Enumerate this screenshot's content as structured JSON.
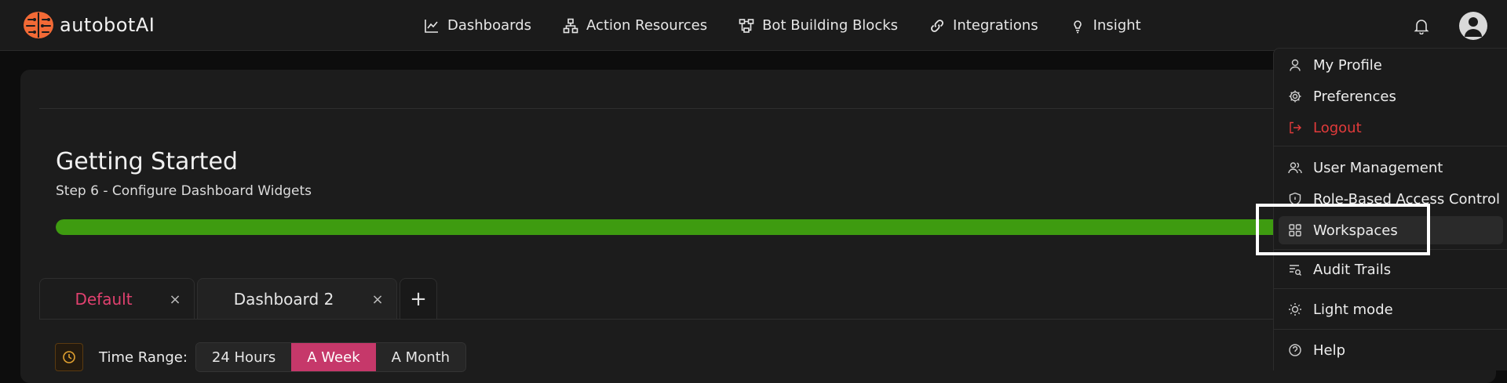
{
  "brand": {
    "name": "autobotAI",
    "logo_icon": "brain-icon",
    "accent": "#f26a36"
  },
  "nav": [
    {
      "label": "Dashboards",
      "icon": "chart-line-icon"
    },
    {
      "label": "Action Resources",
      "icon": "sitemap-icon"
    },
    {
      "label": "Bot Building Blocks",
      "icon": "blocks-icon"
    },
    {
      "label": "Integrations",
      "icon": "link-icon"
    },
    {
      "label": "Insight",
      "icon": "lightbulb-icon"
    }
  ],
  "getting_started": {
    "title": "Getting Started",
    "step": "Step 6 - Configure Dashboard Widgets",
    "progress_percent": 100,
    "progress_color": "#3e9b10"
  },
  "tabs": [
    {
      "label": "Default",
      "color": "#e0416f"
    },
    {
      "label": "Dashboard 2",
      "color": "#e6e6e6"
    }
  ],
  "tabs_add": "+",
  "tab_close": "×",
  "time_range": {
    "label": "Time Range:",
    "options": [
      "24 Hours",
      "A Week",
      "A Month"
    ],
    "selected": "A Week",
    "active_color": "#c6386a"
  },
  "user_menu": {
    "items": [
      {
        "label": "My Profile",
        "icon": "user-icon"
      },
      {
        "label": "Preferences",
        "icon": "gear-icon"
      },
      {
        "label": "Logout",
        "icon": "logout-icon"
      },
      {
        "label": "User Management",
        "icon": "users-icon"
      },
      {
        "label": "Role-Based Access Control",
        "icon": "shield-icon"
      },
      {
        "label": "Workspaces",
        "icon": "grid-icon"
      },
      {
        "label": "Audit Trails",
        "icon": "audit-list-icon"
      },
      {
        "label": "Light mode",
        "icon": "sun-icon"
      },
      {
        "label": "Help",
        "icon": "help-icon"
      }
    ],
    "logout_color": "#e23b3b",
    "highlighted": "Workspaces"
  }
}
